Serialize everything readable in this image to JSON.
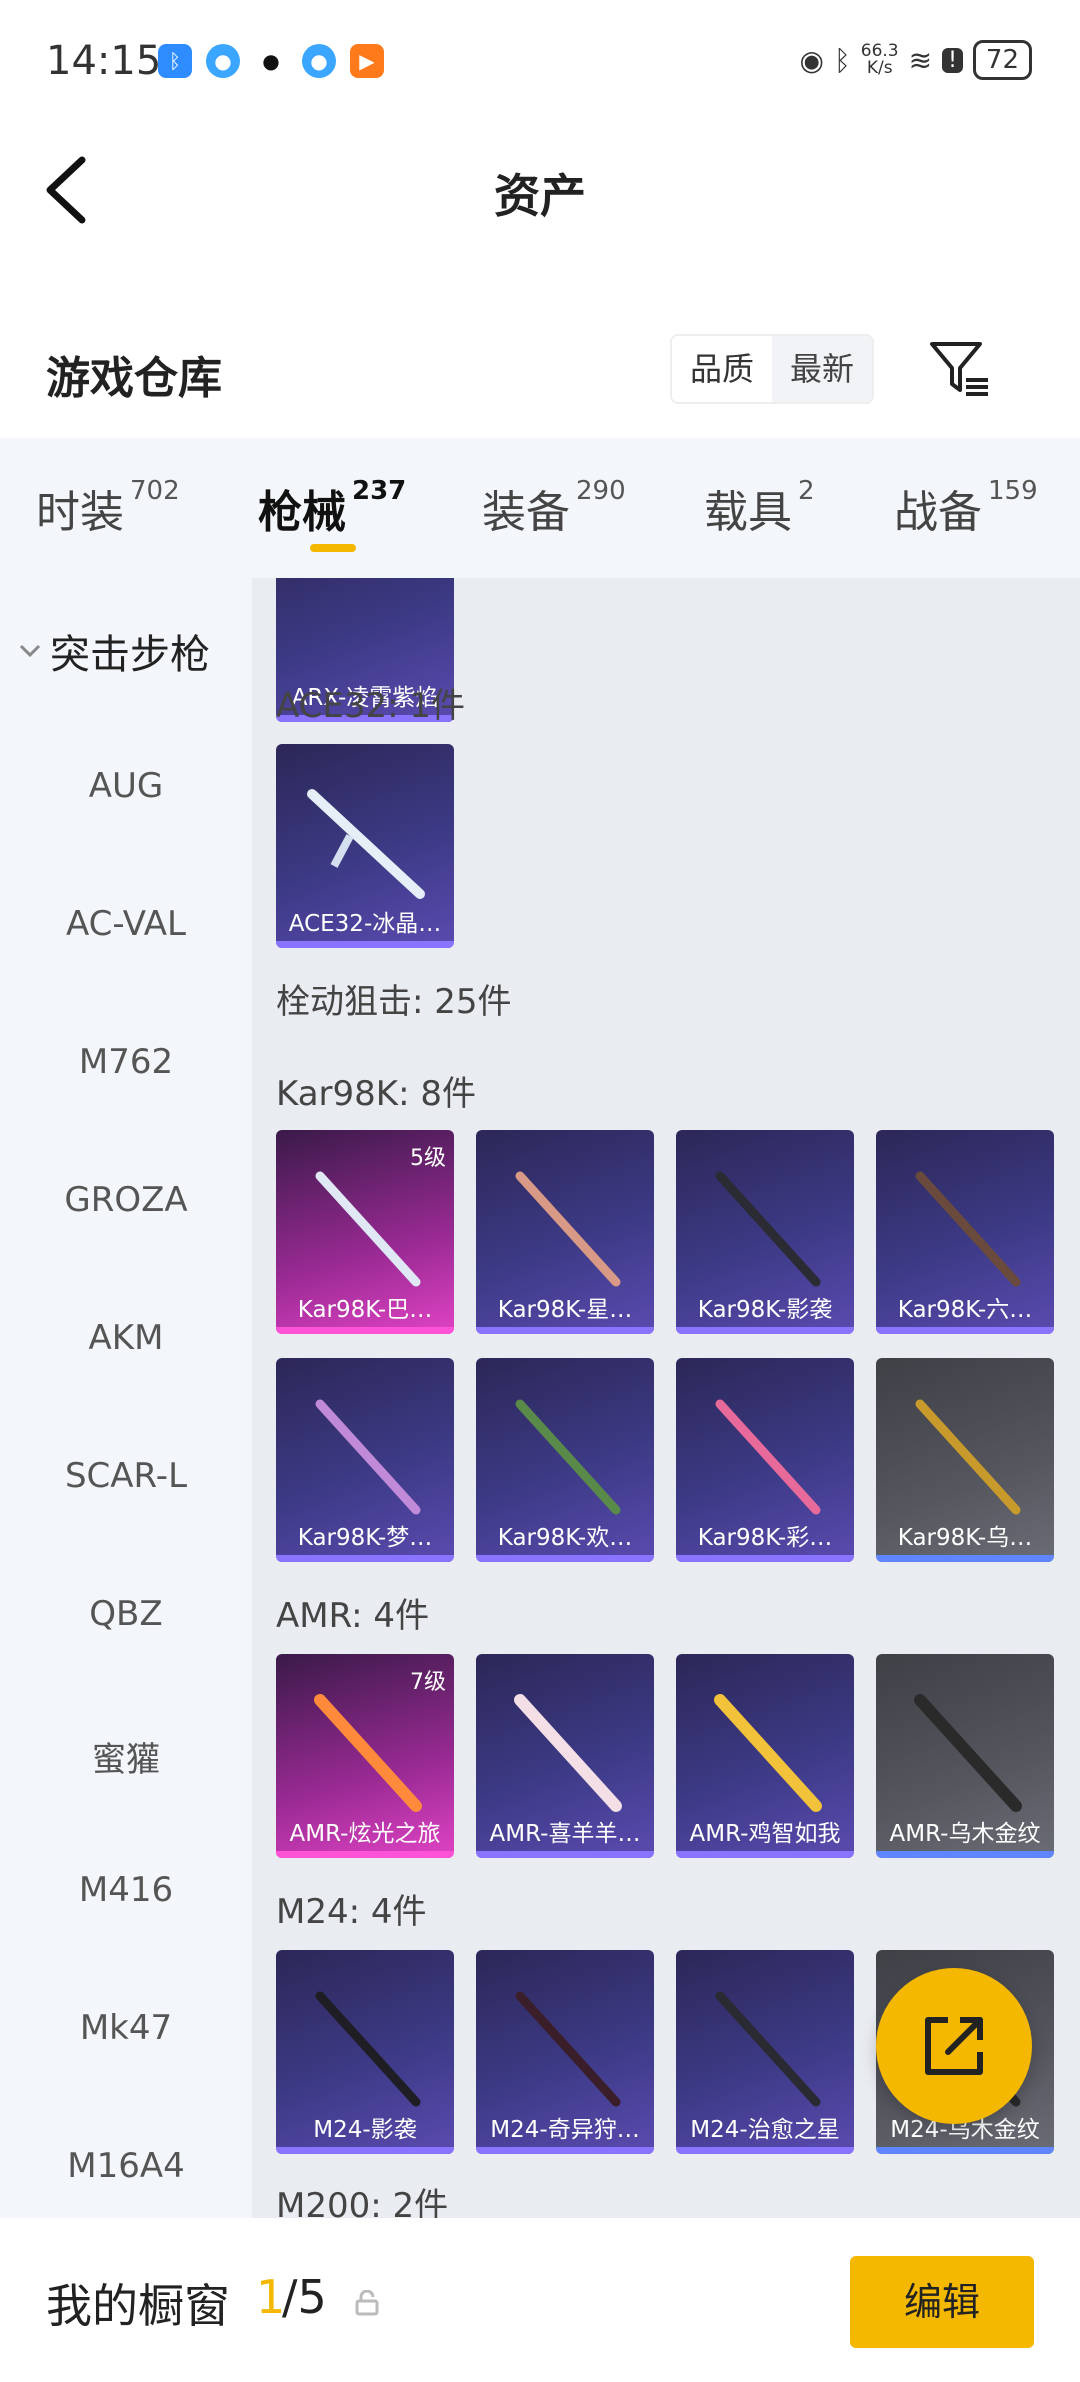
{
  "status_bar": {
    "time": "14:15",
    "net_speed_value": "66.3",
    "net_speed_unit": "K/s",
    "battery": "72"
  },
  "header": {
    "title": "资产"
  },
  "warehouse": {
    "title": "游戏仓库",
    "sort_options": [
      "品质",
      "最新"
    ],
    "selected_sort": "品质"
  },
  "tabs": [
    {
      "label": "时装",
      "count": "702"
    },
    {
      "label": "枪械",
      "count": "237",
      "active": true
    },
    {
      "label": "装备",
      "count": "290"
    },
    {
      "label": "载具",
      "count": "2"
    },
    {
      "label": "战备",
      "count": "159"
    }
  ],
  "sidebar": {
    "group": "突击步枪",
    "items": [
      "AUG",
      "AC-VAL",
      "M762",
      "GROZA",
      "AKM",
      "SCAR-L",
      "QBZ",
      "蜜獾",
      "M416",
      "Mk47",
      "M16A4"
    ]
  },
  "content": {
    "top_partial_card": "ARX-凌霄紫焰",
    "sections": {
      "ace32": "ACE32: 1件",
      "bolt": "栓动狙击: 25件",
      "kar98k": "Kar98K: 8件",
      "amr": "AMR: 4件",
      "m24": "M24: 4件",
      "m200": "M200: 2件"
    },
    "ace32_cards": [
      {
        "name": "ACE32-冰晶…"
      }
    ],
    "kar98k_cards": [
      {
        "name": "Kar98K-巴…",
        "level": "5级"
      },
      {
        "name": "Kar98K-星…"
      },
      {
        "name": "Kar98K-影袭"
      },
      {
        "name": "Kar98K-六…"
      },
      {
        "name": "Kar98K-梦…"
      },
      {
        "name": "Kar98K-欢…"
      },
      {
        "name": "Kar98K-彩…"
      },
      {
        "name": "Kar98K-乌…"
      }
    ],
    "amr_cards": [
      {
        "name": "AMR-炫光之旅",
        "level": "7级"
      },
      {
        "name": "AMR-喜羊羊…"
      },
      {
        "name": "AMR-鸡智如我"
      },
      {
        "name": "AMR-乌木金纹"
      }
    ],
    "m24_cards": [
      {
        "name": "M24-影袭"
      },
      {
        "name": "M24-奇异狩…"
      },
      {
        "name": "M24-治愈之星"
      },
      {
        "name": "M24-乌木金纹"
      }
    ]
  },
  "bottom_bar": {
    "label": "我的橱窗",
    "current": "1",
    "total": "/5",
    "edit_label": "编辑"
  },
  "colors": {
    "accent": "#f5b800",
    "card_purple": "#3d3a86",
    "card_pink": "#9a2a94",
    "card_gray": "#55565e"
  }
}
